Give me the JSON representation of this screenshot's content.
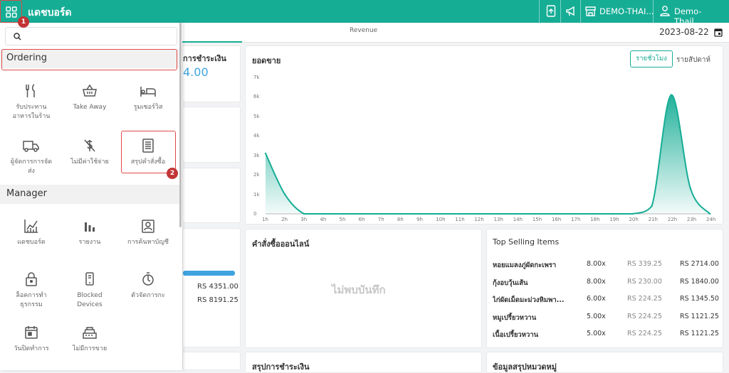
{
  "header": {
    "title": "แดชบอร์ด",
    "store": "DEMO-THAI...",
    "user": "Demo- Thail..."
  },
  "annotations": {
    "step1": "1",
    "step2": "2"
  },
  "tabs": {
    "active": "Revenue",
    "date": "2023-08-22"
  },
  "sidebar": {
    "search_placeholder": "",
    "ordering_title": "Ordering",
    "ordering_items": [
      {
        "line1": "รับประทาน",
        "line2": "อาหารในร้าน",
        "icon": "fork-knife-icon"
      },
      {
        "line1": "Take Away",
        "line2": "",
        "icon": "basket-icon"
      },
      {
        "line1": "รูมเซอร์วิส",
        "line2": "",
        "icon": "bed-icon"
      },
      {
        "line1": "ผู้จัดการการจัด",
        "line2": "ส่ง",
        "icon": "truck-icon"
      },
      {
        "line1": "ไม่มีค่าใช้จ่าย",
        "line2": "",
        "icon": "no-dollar-icon"
      },
      {
        "line1": "สรุปคำสั่งซื้อ",
        "line2": "",
        "icon": "order-summary-icon"
      }
    ],
    "manager_title": "Manager",
    "manager_items": [
      {
        "line1": "แดชบอร์ด",
        "line2": "",
        "icon": "chart-icon"
      },
      {
        "line1": "รายงาน",
        "line2": "",
        "icon": "bar-report-icon"
      },
      {
        "line1": "การค้นหาบัญชี",
        "line2": "",
        "icon": "account-search-icon"
      },
      {
        "line1": "ล็อคการทำ",
        "line2": "ธุรกรรม",
        "icon": "lock-icon"
      },
      {
        "line1": "Blocked",
        "line2": "Devices",
        "icon": "device-icon"
      },
      {
        "line1": "ตัวจัดการกะ",
        "line2": "",
        "icon": "stopwatch-icon"
      },
      {
        "line1": "วันปิดทำการ",
        "line2": "",
        "icon": "calendar-icon"
      },
      {
        "line1": "ไม่มีการขาย",
        "line2": "",
        "icon": "cash-register-icon"
      }
    ]
  },
  "cards": {
    "payment_partial_title": "การชำระเงิน",
    "payment_partial_value": "4.00",
    "amount1": "RS 4351.00",
    "amount2": "RS 8191.25",
    "sales_title": "ยอดขาย",
    "sales_toggle_active": "รายชั่วโมง",
    "sales_toggle_other": "รายสัปดาห์",
    "online_title": "คำสั่งซื้อออนไลน์",
    "online_empty": "ไม่พบบันทึก",
    "top_title": "Top Selling Items",
    "payment_summary_title": "สรุปการชำระเงิน",
    "category_title": "ข้อมูลสรุปหมวดหมู่"
  },
  "top_items": [
    {
      "name": "หอยแมลงภู่ผัดกะเพรา",
      "qty": "8.00x",
      "price": "RS 339.25",
      "total": "RS 2714.00"
    },
    {
      "name": "กุ้งอบวุ้นเส้น",
      "qty": "8.00x",
      "price": "RS 230.00",
      "total": "RS 1840.00"
    },
    {
      "name": "ไก่ผัดเม็ดมะม่วงหิมพา...",
      "qty": "6.00x",
      "price": "RS 224.25",
      "total": "RS 1345.50"
    },
    {
      "name": "หมูเปรี้ยวหวาน",
      "qty": "5.00x",
      "price": "RS 224.25",
      "total": "RS 1121.25"
    },
    {
      "name": "เนื้อเปรี้ยวหวาน",
      "qty": "5.00x",
      "price": "RS 224.25",
      "total": "RS 1121.25"
    }
  ],
  "colors": {
    "brand": "#16ad95",
    "highlight": "#e04a4a"
  },
  "chart_data": {
    "type": "area",
    "title": "ยอดขาย",
    "x": [
      "1h",
      "2h",
      "3h",
      "4h",
      "5h",
      "6h",
      "7h",
      "8h",
      "9h",
      "10h",
      "11h",
      "12h",
      "13h",
      "14h",
      "15h",
      "16h",
      "17h",
      "18h",
      "19h",
      "20h",
      "21h",
      "22h",
      "23h",
      "24h"
    ],
    "values": [
      3100,
      1000,
      0,
      0,
      0,
      0,
      0,
      0,
      0,
      0,
      0,
      0,
      0,
      0,
      0,
      0,
      0,
      0,
      0,
      0,
      400,
      6100,
      1300,
      0
    ],
    "yticks": [
      "0",
      "1k",
      "2k",
      "3k",
      "4k",
      "5k",
      "6k",
      "7k"
    ],
    "ylim": [
      0,
      7000
    ],
    "grid": false
  }
}
